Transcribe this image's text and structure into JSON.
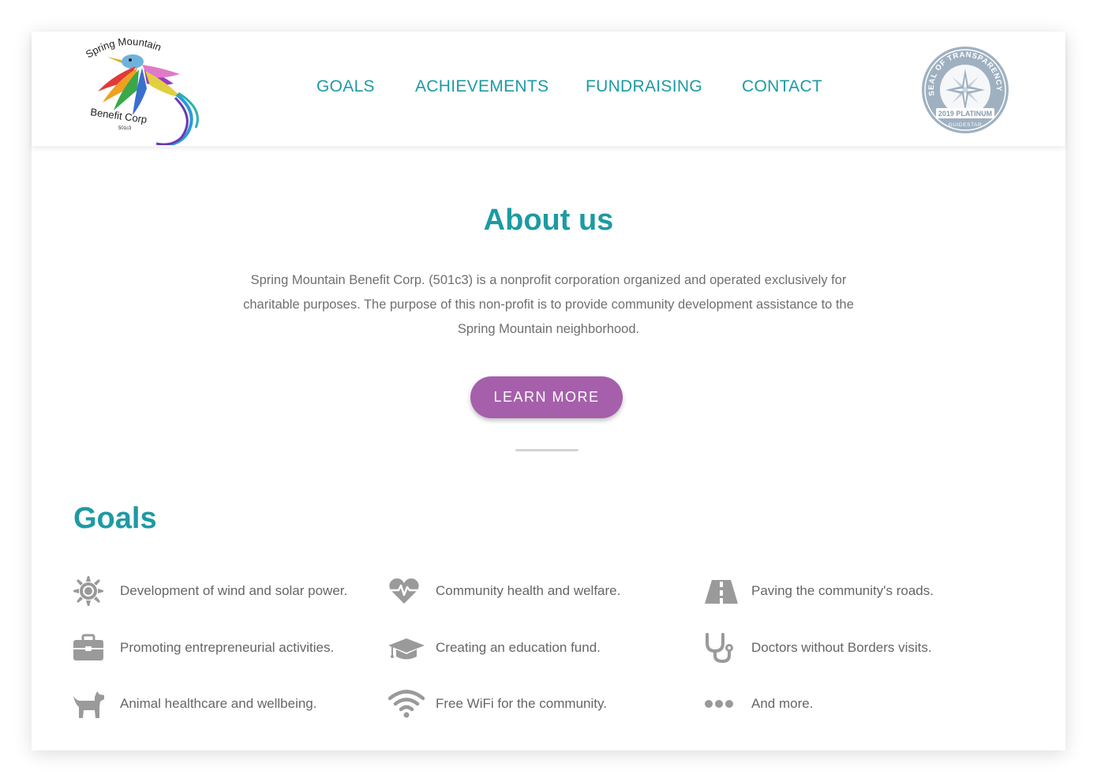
{
  "logo": {
    "line1": "Spring Mountain",
    "line2": "Benefit Corp",
    "line3": "501c3"
  },
  "nav": {
    "items": [
      {
        "label": "GOALS"
      },
      {
        "label": "ACHIEVEMENTS"
      },
      {
        "label": "FUNDRAISING"
      },
      {
        "label": "CONTACT"
      }
    ]
  },
  "seal": {
    "arc_text": "SEAL OF TRANSPARENCY",
    "level": "2019 PLATINUM",
    "brand": "GUIDESTAR"
  },
  "about": {
    "title": "About us",
    "text": "Spring Mountain Benefit Corp. (501c3) is a nonprofit corporation organized and operated exclusively for charitable purposes. The purpose of this non-profit is to provide community development assistance to the Spring Mountain neighborhood.",
    "button": "LEARN MORE"
  },
  "goals": {
    "title": "Goals",
    "items": [
      {
        "icon": "sun-icon",
        "text": "Development of wind and solar power."
      },
      {
        "icon": "heartbeat-icon",
        "text": "Community health and welfare."
      },
      {
        "icon": "road-icon",
        "text": "Paving the community's roads."
      },
      {
        "icon": "briefcase-icon",
        "text": "Promoting entrepreneurial activities."
      },
      {
        "icon": "graduation-cap-icon",
        "text": "Creating an education fund."
      },
      {
        "icon": "stethoscope-icon",
        "text": "Doctors without Borders visits."
      },
      {
        "icon": "dog-icon",
        "text": "Animal healthcare and wellbeing."
      },
      {
        "icon": "wifi-icon",
        "text": "Free WiFi for the community."
      },
      {
        "icon": "ellipsis-icon",
        "text": "And more."
      }
    ]
  },
  "colors": {
    "accent": "#1d9aa3",
    "button": "#a65fab",
    "text": "#6f6f6f",
    "icon": "#9a9a9a",
    "seal": "#9fb1c1"
  }
}
